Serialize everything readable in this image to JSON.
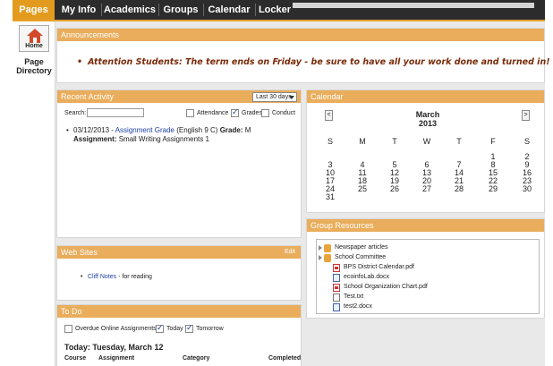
{
  "nav": {
    "tabs": [
      "Pages",
      "My Info",
      "Academics",
      "Groups",
      "Calendar",
      "Locker"
    ],
    "active": "Pages"
  },
  "gutter": {
    "home_label": "Home",
    "page_directory": "Page Directory"
  },
  "announcements": {
    "title": "Announcements",
    "text": "Attention Students: The term ends on Friday - be sure to have all your work done and turned in!"
  },
  "recent_activity": {
    "title": "Recent Activity",
    "range_select": "Last 30 days",
    "search_label": "Search:",
    "search_value": "",
    "filters": [
      {
        "label": "Attendance",
        "checked": false
      },
      {
        "label": "Grades",
        "checked": true
      },
      {
        "label": "Conduct",
        "checked": false
      }
    ],
    "item": {
      "date": "03/12/2013 -",
      "link": "Assignment Grade",
      "course": "(English 9 C)",
      "grade_label": "Grade:",
      "grade_value": "M",
      "assignment_label": "Assignment:",
      "assignment_value": "Small Writing Assignments 1"
    }
  },
  "calendar": {
    "title": "Calendar",
    "month": "March",
    "year": "2013",
    "prev": "<",
    "next": ">",
    "dow": [
      "S",
      "M",
      "T",
      "W",
      "T",
      "F",
      "S"
    ],
    "weeks": [
      [
        "",
        "",
        "",
        "",
        "",
        "1",
        "2"
      ],
      [
        "3",
        "4",
        "5",
        "6",
        "7",
        "8",
        "9"
      ],
      [
        "10",
        "11",
        "12",
        "13",
        "14",
        "15",
        "16"
      ],
      [
        "17",
        "18",
        "19",
        "20",
        "21",
        "22",
        "23"
      ],
      [
        "24",
        "25",
        "26",
        "27",
        "28",
        "29",
        "30"
      ],
      [
        "31",
        "",
        "",
        "",
        "",
        "",
        ""
      ]
    ]
  },
  "group_resources": {
    "title": "Group Resources",
    "items": [
      {
        "name": "Newspaper articles",
        "type": "folder",
        "expandable": true
      },
      {
        "name": "School Committee",
        "type": "folder",
        "expandable": true
      },
      {
        "name": "BPS District Calendar.pdf",
        "type": "pdf",
        "expandable": false
      },
      {
        "name": "ecoinfoLab.docx",
        "type": "doc",
        "expandable": false
      },
      {
        "name": "School Organization Chart.pdf",
        "type": "pdf",
        "expandable": false
      },
      {
        "name": "Test.txt",
        "type": "txt",
        "expandable": false
      },
      {
        "name": "test2.docx",
        "type": "doc",
        "expandable": false
      }
    ]
  },
  "web_sites": {
    "title": "Web Sites",
    "edit": "Edit",
    "items": [
      {
        "link": "Cliff Notes",
        "desc": " - for reading"
      }
    ]
  },
  "todo": {
    "title": "To Do",
    "filters": [
      {
        "label": "Overdue Online Assignments",
        "checked": false
      },
      {
        "label": "Today",
        "checked": true
      },
      {
        "label": "Tomorrow",
        "checked": true
      }
    ],
    "today_heading": "Today: Tuesday, March 12",
    "columns": [
      "Course",
      "Assignment",
      "Category",
      "Completed"
    ]
  },
  "colors": {
    "accent": "#e9ad5b",
    "nav_bg": "#2c2c2c",
    "nav_active": "#e39b1f",
    "announcement_text": "#7a2b0a",
    "link": "#1d3ea8"
  }
}
